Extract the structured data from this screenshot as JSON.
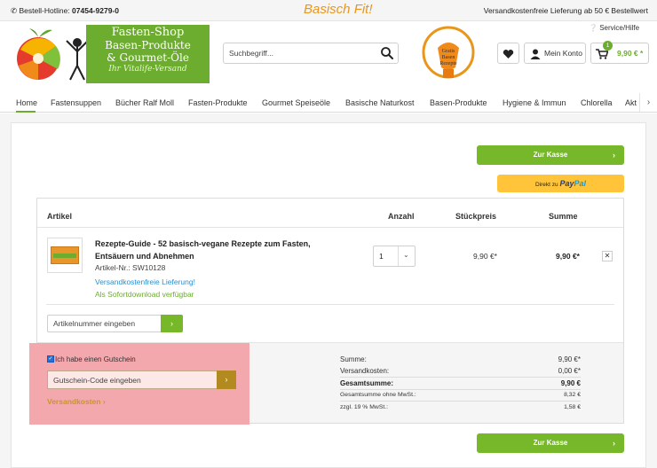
{
  "topbar": {
    "hotline_label": "Bestell-Hotline:",
    "hotline_number": "07454-9279-0",
    "tagline": "Basisch Fit!",
    "shipping_note": "Versandkostenfreie Lieferung ab 50 € Bestellwert"
  },
  "header": {
    "logo": {
      "line1": "Fasten-Shop",
      "line2": "Basen-Produkte",
      "line3": "& Gourmet-Öle",
      "line4": "Ihr Vitalife-Versand"
    },
    "search_placeholder": "Suchbegriff...",
    "badge": {
      "line1": "Gratis",
      "line2": "Basen",
      "line3": "Rezepte"
    },
    "service_label": "Service/Hilfe",
    "account_label": "Mein Konto",
    "cart_count": "1",
    "cart_total": "9,90 € *"
  },
  "nav": {
    "items": [
      "Home",
      "Fastensuppen",
      "Bücher Ralf Moll",
      "Fasten-Produkte",
      "Gourmet Speiseöle",
      "Basische Naturkost",
      "Basen-Produkte",
      "Hygiene & Immun",
      "Chlorella",
      "Akt"
    ]
  },
  "buttons": {
    "checkout": "Zur Kasse",
    "paypal_prefix": "Direkt zu",
    "paypal_brand_1": "Pay",
    "paypal_brand_2": "Pal"
  },
  "table": {
    "headers": {
      "article": "Artikel",
      "quantity": "Anzahl",
      "unit_price": "Stückpreis",
      "total": "Summe"
    },
    "item": {
      "name": "Rezepte-Guide - 52 basisch-vegane Rezepte zum Fasten, Entsäuern und Abnehmen",
      "article_number": "Artikel-Nr.: SW10128",
      "shipping": "Versandkostenfreie Lieferung!",
      "download": "Als Sofortdownload verfügbar",
      "quantity": "1",
      "unit_price": "9,90 €*",
      "total": "9,90 €*",
      "remove": "✕"
    },
    "article_input_placeholder": "Artikelnummer eingeben"
  },
  "voucher": {
    "checkbox_label": "Ich habe einen Gutschein",
    "input_placeholder": "Gutschein-Code eingeben",
    "shipping_link": "Versandkosten"
  },
  "summary": {
    "rows": [
      {
        "label": "Summe:",
        "value": "9,90 €*"
      },
      {
        "label": "Versandkosten:",
        "value": "0,00 €*"
      },
      {
        "label": "Gesamtsumme:",
        "value": "9,90 €"
      },
      {
        "label": "Gesamtsumme ohne MwSt.:",
        "value": "8,32 €"
      },
      {
        "label": "zzgl. 19 % MwSt.:",
        "value": "1,58 €"
      }
    ]
  },
  "colors": {
    "brand_green": "#76b82a",
    "accent_orange": "#e8961c",
    "paypal_yellow": "#ffc439",
    "highlight": "#f3a8ae",
    "voucher_button": "#b38a1f",
    "link_blue": "#2a8fd1"
  }
}
